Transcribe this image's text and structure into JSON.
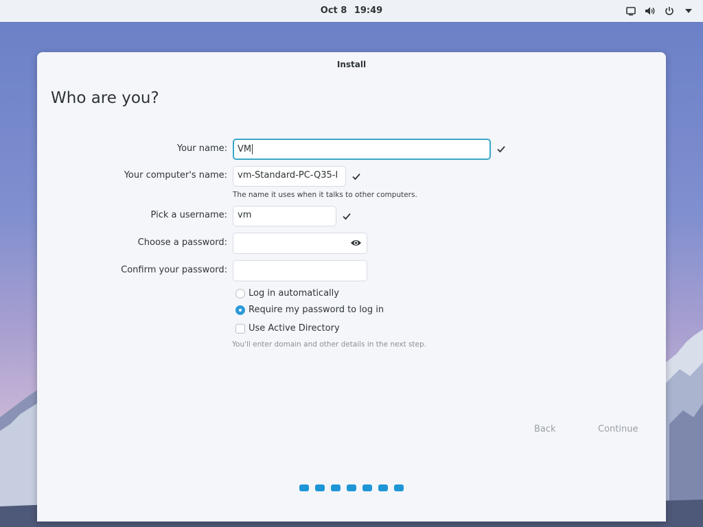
{
  "topbar": {
    "date": "Oct 8",
    "time": "19:49",
    "icons": [
      "display-icon",
      "volume-icon",
      "power-icon",
      "menu-arrow-icon"
    ]
  },
  "window": {
    "title": "Install",
    "heading": "Who are you?"
  },
  "form": {
    "your_name": {
      "label": "Your name:",
      "value": "VM",
      "valid": true
    },
    "computer_name": {
      "label": "Your computer's name:",
      "value": "vm-Standard-PC-Q35-I",
      "valid": true,
      "hint": "The name it uses when it talks to other computers."
    },
    "username": {
      "label": "Pick a username:",
      "value": "vm",
      "valid": true
    },
    "password": {
      "label": "Choose a password:",
      "value": ""
    },
    "confirm_password": {
      "label": "Confirm your password:",
      "value": ""
    },
    "login_options": [
      {
        "label": "Log in automatically",
        "selected": false
      },
      {
        "label": "Require my password to log in",
        "selected": true
      }
    ],
    "active_directory": {
      "label": "Use Active Directory",
      "checked": false,
      "hint": "You'll enter domain and other details in the next step."
    }
  },
  "buttons": {
    "back": "Back",
    "continue": "Continue"
  },
  "progress": {
    "steps": 7
  },
  "colors": {
    "accent": "#1e96d6",
    "focus_border": "#3aa6c9",
    "panel": "#f4f6fa"
  }
}
